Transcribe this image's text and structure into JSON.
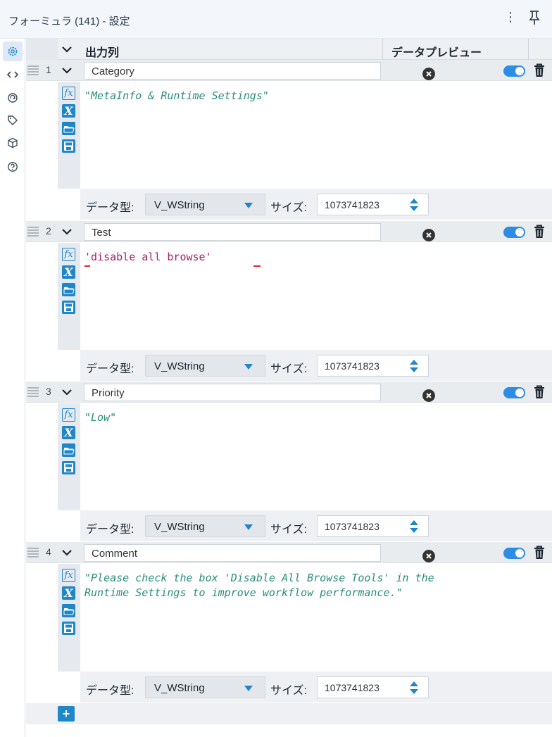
{
  "window": {
    "title": "フォーミュラ (141) - 設定",
    "menu_glyph": "⋮",
    "pin_icon": "pin-icon"
  },
  "rail": {
    "icons": [
      "gear-icon",
      "code-icon",
      "refresh-icon",
      "tag-icon",
      "cube-icon",
      "help-icon"
    ]
  },
  "grid": {
    "header_output": "出力列",
    "header_preview": "データプレビュー"
  },
  "labels": {
    "data_type": "データ型:",
    "size": "サイズ:"
  },
  "rows": [
    {
      "num": "1",
      "name": "Category",
      "expression": "\"MetaInfo & Runtime Settings\"",
      "data_type": "V_WString",
      "size": "1073741823",
      "enabled": true
    },
    {
      "num": "2",
      "name": "Test",
      "expression": "'disable all browse'",
      "data_type": "V_WString",
      "size": "1073741823",
      "enabled": true
    },
    {
      "num": "3",
      "name": "Priority",
      "expression": "\"Low\"",
      "data_type": "V_WString",
      "size": "1073741823",
      "enabled": true
    },
    {
      "num": "4",
      "name": "Comment",
      "expression": "\"Please check the box 'Disable All Browse Tools' in the\nRuntime Settings to improve workflow performance.\"",
      "data_type": "V_WString",
      "size": "1073741823",
      "enabled": true
    }
  ],
  "add_button_label": "+",
  "colors": {
    "accent": "#1f86c8",
    "toggle_on": "#2d8ce6",
    "expr_string": "#2a8c7c",
    "expr_single_quote": "#a81e6a",
    "error_underline": "#e3242b"
  }
}
